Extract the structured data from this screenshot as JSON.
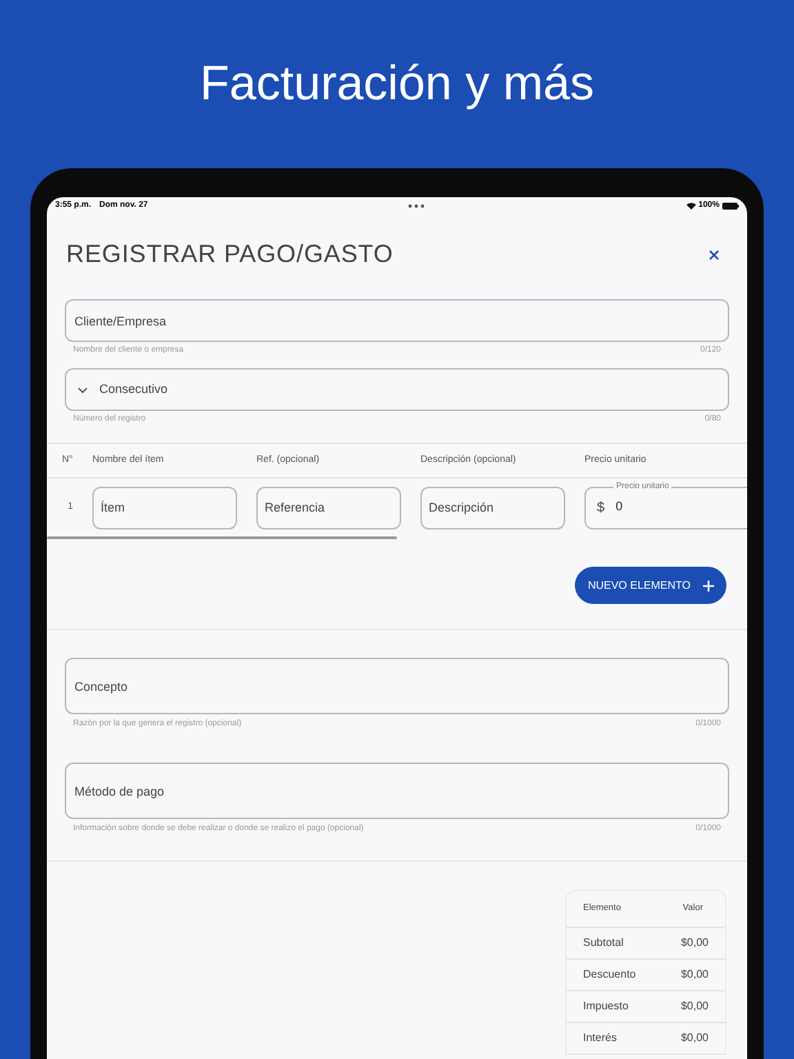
{
  "headline": "Facturación y más",
  "status_bar": {
    "time": "3:55 p.m.",
    "date": "Dom nov. 27",
    "battery": "100%"
  },
  "form": {
    "title": "REGISTRAR PAGO/GASTO",
    "fields": [
      {
        "kind": "text",
        "placeholder": "Cliente/Empresa",
        "helper": "Nombre del cliente o empresa",
        "counter": "0/120"
      },
      {
        "kind": "select",
        "placeholder": "Consecutivo",
        "helper": "Número del registro",
        "counter": "0/80"
      }
    ],
    "items_table": {
      "columns": [
        "N°",
        "Nombre del ítem",
        "Ref. (opcional)",
        "Descripción (opcional)",
        "Precio unitario"
      ],
      "rows": [
        {
          "number": "1",
          "fields": [
            {
              "kind": "text",
              "placeholder": "Ítem"
            },
            {
              "kind": "text",
              "placeholder": "Referencia"
            },
            {
              "kind": "text",
              "placeholder": "Descripción"
            },
            {
              "kind": "price",
              "label": "Precio unitario",
              "prefix": "$",
              "value": "0"
            }
          ]
        }
      ]
    },
    "add_button": {
      "label": "NUEVO ELEMENTO"
    },
    "notes": [
      {
        "placeholder": "Concepto",
        "helper": "Razón por la que genera el registro (opcional)",
        "counter": "0/1000"
      },
      {
        "placeholder": "Método de pago",
        "helper": "Información sobre donde se debe realizar o donde se realizo el pago (opcional)",
        "counter": "0/1000"
      }
    ],
    "summary": {
      "columns": [
        "Elemento",
        "Valor"
      ],
      "rows": [
        {
          "label": "Subtotal",
          "value": "$0,00"
        },
        {
          "label": "Descuento",
          "value": "$0,00"
        },
        {
          "label": "Impuesto",
          "value": "$0,00"
        },
        {
          "label": "Interés",
          "value": "$0,00"
        }
      ]
    }
  }
}
